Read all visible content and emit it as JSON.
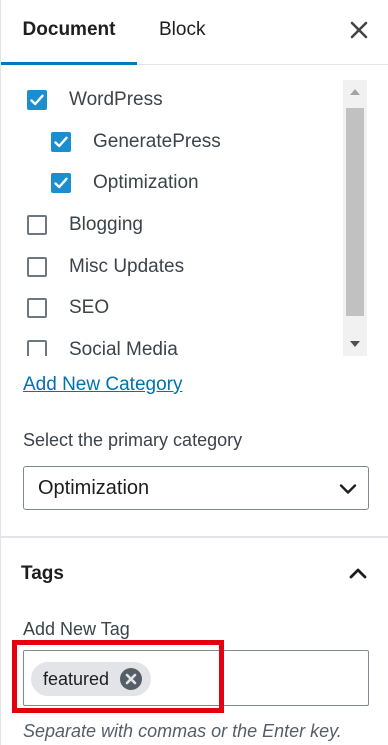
{
  "tabs": [
    {
      "label": "Document",
      "active": true
    },
    {
      "label": "Block",
      "active": false
    }
  ],
  "close_icon": "close-icon",
  "categories": [
    {
      "label": "WordPress",
      "checked": true,
      "level": 0
    },
    {
      "label": "GeneratePress",
      "checked": true,
      "level": 1
    },
    {
      "label": "Optimization",
      "checked": true,
      "level": 1
    },
    {
      "label": "Blogging",
      "checked": false,
      "level": 0
    },
    {
      "label": "Misc Updates",
      "checked": false,
      "level": 0
    },
    {
      "label": "SEO",
      "checked": false,
      "level": 0
    },
    {
      "label": "Social Media",
      "checked": false,
      "level": 0
    }
  ],
  "add_category_link": "Add New Category",
  "primary_category": {
    "label": "Select the primary category",
    "selected": "Optimization"
  },
  "tags": {
    "title": "Tags",
    "add_label": "Add New Tag",
    "tokens": [
      "featured"
    ],
    "help_text": "Separate with commas or the Enter key."
  },
  "colors": {
    "accent": "#007cba",
    "checkbox_checked": "#1b8ecf",
    "link": "#0073aa",
    "highlight": "#e3000f"
  }
}
